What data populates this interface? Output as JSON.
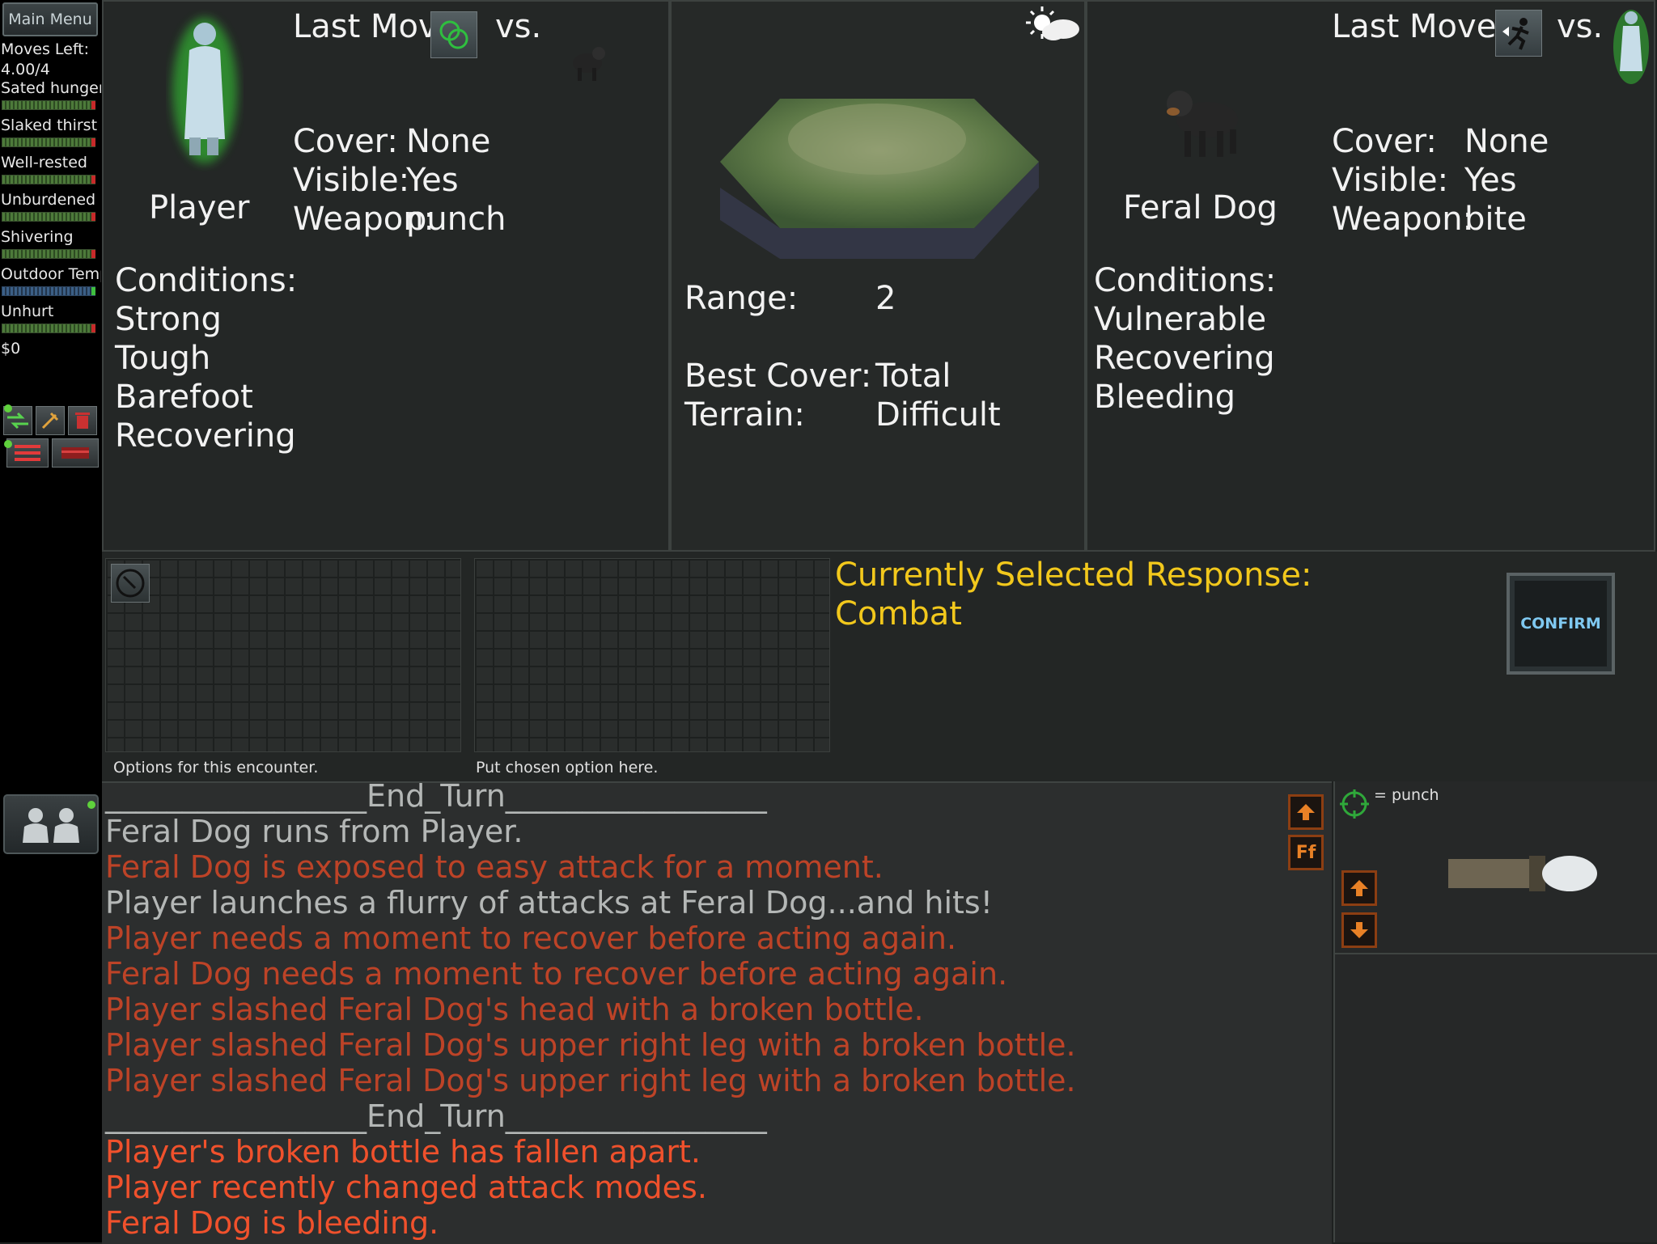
{
  "sidebar": {
    "main_menu": "Main Menu",
    "moves_left_label": "Moves Left:",
    "moves_left_value": "4.00/4",
    "stats": [
      {
        "label": "Sated hunger",
        "bar": "green"
      },
      {
        "label": "Slaked thirst",
        "bar": "green"
      },
      {
        "label": "Well-rested",
        "bar": "green"
      },
      {
        "label": "Unburdened",
        "bar": "green"
      },
      {
        "label": "Shivering",
        "bar": "green"
      },
      {
        "label": "Outdoor Temp",
        "bar": "blue"
      },
      {
        "label": "Unhurt",
        "bar": "green"
      }
    ],
    "money": "$0"
  },
  "player": {
    "last_move_label": "Last Move:",
    "vs_label": "vs.",
    "name": "Player",
    "cover_label": "Cover:",
    "cover_value": "None",
    "visible_label": "Visible:",
    "visible_value": "Yes",
    "weapon_label": "Weapon:",
    "weapon_value": "punch",
    "conditions_label": "Conditions:",
    "conditions": [
      "Strong",
      "Tough",
      "Barefoot",
      "Recovering"
    ]
  },
  "terrain": {
    "range_label": "Range:",
    "range_value": "2",
    "best_cover_label": "Best Cover:",
    "best_cover_value": "Total",
    "terrain_label": "Terrain:",
    "terrain_value": "Difficult",
    "weather_icon": "partly-cloudy-icon"
  },
  "enemy": {
    "last_move_label": "Last Move:",
    "vs_label": "vs.",
    "name": "Feral Dog",
    "cover_label": "Cover:",
    "cover_value": "None",
    "visible_label": "Visible:",
    "visible_value": "Yes",
    "weapon_label": "Weapon:",
    "weapon_value": "bite",
    "conditions_label": "Conditions:",
    "conditions": [
      "Vulnerable",
      "Recovering",
      "Bleeding"
    ]
  },
  "encounter": {
    "options_caption": "Options for this encounter.",
    "chosen_caption": "Put chosen option here.",
    "selected_label": "Currently Selected Response:",
    "selected_value": "Combat",
    "confirm_label": "CONFIRM"
  },
  "log": {
    "lines": [
      {
        "text": "_________________End_Turn_________________",
        "style": "gray"
      },
      {
        "text": "Feral Dog runs from Player.",
        "style": "gray"
      },
      {
        "text": "Feral Dog is exposed to easy attack for a moment.",
        "style": "red"
      },
      {
        "text": "Player launches a flurry of attacks at Feral Dog...and hits!",
        "style": "gray"
      },
      {
        "text": "Player needs a moment to recover before acting again.",
        "style": "red"
      },
      {
        "text": "Feral Dog needs a moment to recover before acting again.",
        "style": "red"
      },
      {
        "text": "Player slashed Feral Dog's head with a broken bottle.",
        "style": "red"
      },
      {
        "text": "Player slashed Feral Dog's upper right leg with a broken bottle.",
        "style": "red"
      },
      {
        "text": "Player slashed Feral Dog's upper right leg with a broken bottle.",
        "style": "red"
      },
      {
        "text": "_________________End_Turn_________________",
        "style": "gray"
      },
      {
        "text": "Player's broken bottle has fallen apart.",
        "style": "orange"
      },
      {
        "text": "Player recently changed attack modes.",
        "style": "orange"
      },
      {
        "text": "Feral Dog is bleeding.",
        "style": "orange"
      }
    ],
    "font_button": "Ff"
  },
  "weapon_panel": {
    "legend": "= punch"
  },
  "colors": {
    "condition_text": "#f2f2f2",
    "response_yellow": "#f2c81c",
    "log_red": "#bd4327",
    "log_orange": "#f0512c",
    "log_gray": "#b4b7b6",
    "confirm_text": "#7fc8f0"
  }
}
